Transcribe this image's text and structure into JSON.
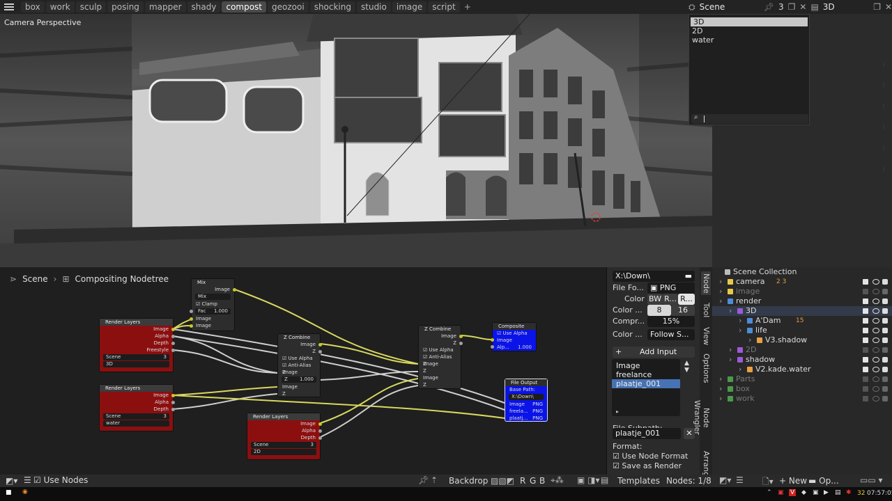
{
  "workspaces": [
    "box",
    "work",
    "sculp",
    "posing",
    "mapper",
    "shady",
    "compost",
    "geozooi",
    "shocking",
    "studio",
    "image",
    "script"
  ],
  "active_workspace": "compost",
  "scene_header": {
    "scene_label": "Scene",
    "users_count": "3",
    "view_layer": "3D"
  },
  "scene_dropdown": {
    "items": [
      "3D",
      "2D",
      "water"
    ],
    "selected": "3D"
  },
  "viewport": {
    "label": "Camera Perspective"
  },
  "node_editor": {
    "breadcrumb_scene": "Scene",
    "breadcrumb_tree": "Compositing Nodetree"
  },
  "nodes": {
    "mix": {
      "title": "Mix",
      "out_image": "Image",
      "mode": "Mix",
      "clamp": "Clamp",
      "fac_label": "Fac",
      "fac_value": "1.000",
      "in_image1": "Image",
      "in_image2": "Image"
    },
    "rl1": {
      "title": "Render Layers",
      "out": [
        "Image",
        "Alpha",
        "Depth",
        "Freestyle"
      ],
      "scene": "Scene",
      "num": "3",
      "layer": "3D"
    },
    "rl2": {
      "title": "Render Layers",
      "out": [
        "Image",
        "Alpha",
        "Depth"
      ],
      "scene": "Scene",
      "num": "3",
      "layer": "water"
    },
    "rl3": {
      "title": "Render Layers",
      "out": [
        "Image",
        "Alpha",
        "Depth"
      ],
      "scene": "Scene",
      "num": "3",
      "layer": "2D"
    },
    "zc1": {
      "title": "Z Combine",
      "out_image": "Image",
      "out_z": "Z",
      "use_alpha": "Use Alpha",
      "anti_alias": "Anti-Alias Z",
      "in_image": "Image",
      "in_z_label": "Z",
      "in_z_value": "1.000",
      "in_image2": "Image",
      "in_z2": "Z"
    },
    "zc2": {
      "title": "Z Combine",
      "out_image": "Image",
      "out_z": "Z",
      "use_alpha": "Use Alpha",
      "anti_alias": "Anti-Alias Z",
      "in_image": "Image",
      "in_z": "Z",
      "in_image2": "Image",
      "in_z2": "Z"
    },
    "composite": {
      "title": "Composite",
      "use_alpha": "Use Alpha",
      "in_image": "Image",
      "alpha_label": "Alp...",
      "alpha_value": "1.000"
    },
    "fileout": {
      "title": "File Output",
      "base_path_label": "Base Path:",
      "base_path": "X:\\Down\\",
      "inputs": [
        {
          "name": "Image",
          "fmt": "PNG"
        },
        {
          "name": "freela...",
          "fmt": "PNG"
        },
        {
          "name": "plaatj...",
          "fmt": "PNG"
        }
      ]
    }
  },
  "node_panel": {
    "path": "X:\\Down\\",
    "file_format_label": "File Fo...",
    "file_format": "PNG",
    "color_label": "Color",
    "color_opts": [
      "BW",
      "R...",
      "R..."
    ],
    "color_depth_label": "Color ...",
    "color_depth_opts": [
      "8",
      "16"
    ],
    "compression_label": "Compr...",
    "compression": "15%",
    "color_mgmt_label": "Color ...",
    "color_mgmt": "Follow S...",
    "add_input": "Add Input",
    "inputs": [
      "Image",
      "freelance",
      "plaatje_001"
    ],
    "selected_input": "plaatje_001",
    "file_subpath_label": "File Subpath:",
    "file_subpath": "plaatje_001",
    "format_label": "Format:",
    "use_node_format": "Use Node Format",
    "save_as_render": "Save as Render"
  },
  "side_tabs": [
    "Node",
    "Tool",
    "View",
    "Options",
    "Node Wrangler",
    "Arrang"
  ],
  "outliner": {
    "title": "Scene Collection",
    "rows": [
      {
        "name": "camera",
        "indent": 1,
        "color": "#e8c948",
        "dim": false,
        "extra": "2 3"
      },
      {
        "name": "image",
        "indent": 1,
        "color": "#e8c948",
        "dim": true
      },
      {
        "name": "render",
        "indent": 1,
        "color": "#4d8cd8",
        "dim": false
      },
      {
        "name": "3D",
        "indent": 2,
        "color": "#9c5ad8",
        "dim": false,
        "hl": true
      },
      {
        "name": "A'Dam",
        "indent": 3,
        "color": "#4d8cd8",
        "dim": false,
        "extra": "15"
      },
      {
        "name": "life",
        "indent": 3,
        "color": "#4d8cd8",
        "dim": false
      },
      {
        "name": "V3.shadow",
        "indent": 4,
        "color": "#e8a040",
        "dim": false
      },
      {
        "name": "2D",
        "indent": 2,
        "color": "#9c5ad8",
        "dim": true
      },
      {
        "name": "shadow",
        "indent": 2,
        "color": "#9c5ad8",
        "dim": false
      },
      {
        "name": "V2.kade.water",
        "indent": 3,
        "color": "#e8a040",
        "dim": false
      },
      {
        "name": "Parts",
        "indent": 1,
        "color": "#4a9a4a",
        "dim": true
      },
      {
        "name": "box",
        "indent": 1,
        "color": "#4a9a4a",
        "dim": true
      },
      {
        "name": "work",
        "indent": 1,
        "color": "#4a9a4a",
        "dim": true
      }
    ]
  },
  "bottom_bar": {
    "use_nodes": "Use Nodes",
    "backdrop": "Backdrop",
    "channels": [
      "R",
      "G",
      "B"
    ],
    "templates": "Templates",
    "nodes_count": "Nodes: 1/8",
    "new_label": "New",
    "op_label": "Op..."
  },
  "taskbar": {
    "count": "32",
    "time": "07:57:05"
  },
  "colors": {
    "accent": "#4772b3",
    "node_red": "#8c0f10",
    "node_blue": "#0a13e8",
    "socket_yellow": "#c7c729"
  }
}
